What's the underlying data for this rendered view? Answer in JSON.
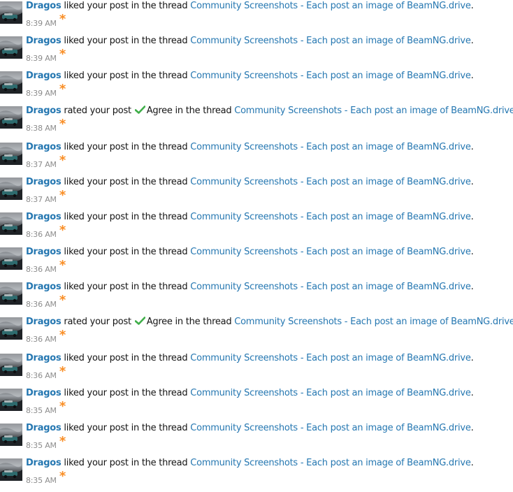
{
  "alerts": [
    {
      "user": "Dragos",
      "action": "liked your post in the thread",
      "rating": "",
      "thread": "Community Screenshots - Each post an image of BeamNG.drive",
      "end": ".",
      "time": "8:39 AM",
      "new_mark": "*"
    },
    {
      "user": "Dragos",
      "action": "liked your post in the thread",
      "rating": "",
      "thread": "Community Screenshots - Each post an image of BeamNG.drive",
      "end": ".",
      "time": "8:39 AM",
      "new_mark": "*"
    },
    {
      "user": "Dragos",
      "action": "liked your post in the thread",
      "rating": "",
      "thread": "Community Screenshots - Each post an image of BeamNG.drive",
      "end": ".",
      "time": "8:39 AM",
      "new_mark": "*"
    },
    {
      "user": "Dragos",
      "action": "rated your post",
      "rating": "Agree in the thread",
      "thread": "Community Screenshots - Each post an image of BeamNG.drive",
      "end": ".",
      "time": "8:38 AM",
      "new_mark": "*"
    },
    {
      "user": "Dragos",
      "action": "liked your post in the thread",
      "rating": "",
      "thread": "Community Screenshots - Each post an image of BeamNG.drive",
      "end": ".",
      "time": "8:37 AM",
      "new_mark": "*"
    },
    {
      "user": "Dragos",
      "action": "liked your post in the thread",
      "rating": "",
      "thread": "Community Screenshots - Each post an image of BeamNG.drive",
      "end": ".",
      "time": "8:37 AM",
      "new_mark": "*"
    },
    {
      "user": "Dragos",
      "action": "liked your post in the thread",
      "rating": "",
      "thread": "Community Screenshots - Each post an image of BeamNG.drive",
      "end": ".",
      "time": "8:36 AM",
      "new_mark": "*"
    },
    {
      "user": "Dragos",
      "action": "liked your post in the thread",
      "rating": "",
      "thread": "Community Screenshots - Each post an image of BeamNG.drive",
      "end": ".",
      "time": "8:36 AM",
      "new_mark": "*"
    },
    {
      "user": "Dragos",
      "action": "liked your post in the thread",
      "rating": "",
      "thread": "Community Screenshots - Each post an image of BeamNG.drive",
      "end": ".",
      "time": "8:36 AM",
      "new_mark": "*"
    },
    {
      "user": "Dragos",
      "action": "rated your post",
      "rating": "Agree in the thread",
      "thread": "Community Screenshots - Each post an image of BeamNG.drive",
      "end": ".",
      "time": "8:36 AM",
      "new_mark": "*"
    },
    {
      "user": "Dragos",
      "action": "liked your post in the thread",
      "rating": "",
      "thread": "Community Screenshots - Each post an image of BeamNG.drive",
      "end": ".",
      "time": "8:36 AM",
      "new_mark": "*"
    },
    {
      "user": "Dragos",
      "action": "liked your post in the thread",
      "rating": "",
      "thread": "Community Screenshots - Each post an image of BeamNG.drive",
      "end": ".",
      "time": "8:35 AM",
      "new_mark": "*"
    },
    {
      "user": "Dragos",
      "action": "liked your post in the thread",
      "rating": "",
      "thread": "Community Screenshots - Each post an image of BeamNG.drive",
      "end": ".",
      "time": "8:35 AM",
      "new_mark": "*"
    },
    {
      "user": "Dragos",
      "action": "liked your post in the thread",
      "rating": "",
      "thread": "Community Screenshots - Each post an image of BeamNG.drive",
      "end": ".",
      "time": "8:35 AM",
      "new_mark": "*"
    }
  ],
  "colors": {
    "link": "#2577b1",
    "timestamp": "#8c8c8c",
    "new_indicator": "#f98d24",
    "check": "#3fae49"
  },
  "icons": {
    "rating": "check-icon",
    "avatar": "avatar-image"
  }
}
